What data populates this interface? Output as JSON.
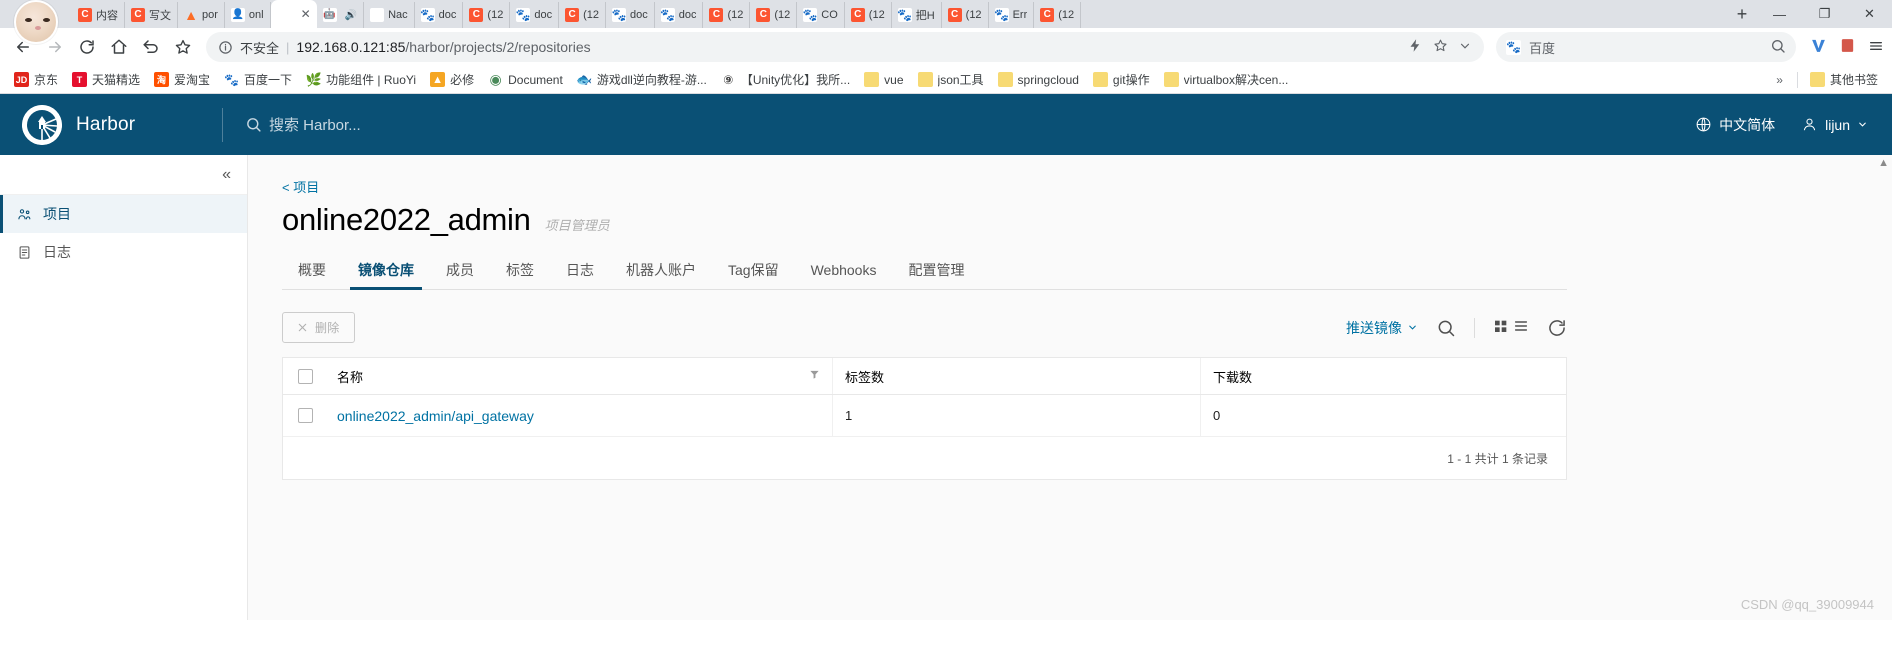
{
  "browser": {
    "tabs": [
      {
        "label": "内容",
        "icon": "csdn-icon",
        "active": false
      },
      {
        "label": "写文",
        "icon": "csdn-icon",
        "active": false
      },
      {
        "label": "por",
        "icon": "gitlab-icon",
        "active": false
      },
      {
        "label": "onl",
        "icon": "avatar-icon",
        "active": false
      },
      {
        "label": "",
        "icon": "harbor-icon",
        "active": true
      },
      {
        "label": "",
        "icon": "robot-icon",
        "active": false
      },
      {
        "label": "Nac",
        "icon": "nacos-icon",
        "active": false
      },
      {
        "label": "doc",
        "icon": "baidu-icon",
        "active": false
      },
      {
        "label": "(12",
        "icon": "csdn-icon",
        "active": false
      },
      {
        "label": "doc",
        "icon": "baidu-icon",
        "active": false
      },
      {
        "label": "(12",
        "icon": "csdn-icon",
        "active": false
      },
      {
        "label": "doc",
        "icon": "baidu-icon",
        "active": false
      },
      {
        "label": "doc",
        "icon": "baidu-icon",
        "active": false
      },
      {
        "label": "(12",
        "icon": "csdn-icon",
        "active": false
      },
      {
        "label": "(12",
        "icon": "csdn-icon",
        "active": false
      },
      {
        "label": "CO",
        "icon": "baidu-icon",
        "active": false
      },
      {
        "label": "(12",
        "icon": "csdn-icon",
        "active": false
      },
      {
        "label": "把H",
        "icon": "baidu-icon",
        "active": false
      },
      {
        "label": "(12",
        "icon": "csdn-icon",
        "active": false
      },
      {
        "label": "Err",
        "icon": "baidu-icon",
        "active": false
      },
      {
        "label": "(12",
        "icon": "csdn-icon",
        "active": false
      }
    ],
    "new_tab_label": "+",
    "window_controls": {
      "minimize": "—",
      "maximize": "❐",
      "close": "✕"
    },
    "toolbar": {
      "back": "←",
      "forward": "→",
      "reload": "⟳",
      "home": "⌂",
      "undo": "↺",
      "bookmark": "☆",
      "insecure_label": "不安全",
      "url_host": "192.168.0.121:85",
      "url_path": "/harbor/projects/2/repositories",
      "search_engine_label": "百度",
      "search_icon": "search-icon"
    },
    "bookmarks": [
      {
        "label": "京东",
        "icon": "jd-icon"
      },
      {
        "label": "天猫精选",
        "icon": "tmall-icon"
      },
      {
        "label": "爱淘宝",
        "icon": "taobao-icon"
      },
      {
        "label": "百度一下",
        "icon": "baidu-icon"
      },
      {
        "label": "功能组件 | RuoYi",
        "icon": "ruoyi-icon"
      },
      {
        "label": "必修",
        "icon": "bixiu-icon"
      },
      {
        "label": "Document",
        "icon": "document-icon"
      },
      {
        "label": "游戏dll逆向教程-游...",
        "icon": "game-icon"
      },
      {
        "label": "【Unity优化】我所...",
        "icon": "unity-icon"
      },
      {
        "label": "vue",
        "icon": "folder-icon"
      },
      {
        "label": "json工具",
        "icon": "folder-icon"
      },
      {
        "label": "springcloud",
        "icon": "folder-icon"
      },
      {
        "label": "git操作",
        "icon": "folder-icon"
      },
      {
        "label": "virtualbox解决cen...",
        "icon": "folder-icon"
      }
    ],
    "bookmarks_overflow": "»",
    "bookmarks_other": {
      "label": "其他书签",
      "icon": "folder-icon"
    }
  },
  "harbor": {
    "brand": "Harbor",
    "search_placeholder": "搜索 Harbor...",
    "language": "中文简体",
    "user": "lijun",
    "collapse_icon": "«"
  },
  "sidebar": {
    "items": [
      {
        "label": "项目",
        "icon": "projects-icon",
        "active": true
      },
      {
        "label": "日志",
        "icon": "logs-icon",
        "active": false
      }
    ]
  },
  "main": {
    "breadcrumb": "< 项目",
    "title": "online2022_admin",
    "role": "项目管理员",
    "tabs": [
      {
        "label": "概要",
        "active": false
      },
      {
        "label": "镜像仓库",
        "active": true
      },
      {
        "label": "成员",
        "active": false
      },
      {
        "label": "标签",
        "active": false
      },
      {
        "label": "日志",
        "active": false
      },
      {
        "label": "机器人账户",
        "active": false
      },
      {
        "label": "Tag保留",
        "active": false
      },
      {
        "label": "Webhooks",
        "active": false
      },
      {
        "label": "配置管理",
        "active": false
      }
    ],
    "toolbar": {
      "delete_label": "删除",
      "delete_icon": "close-icon",
      "push_image_label": "推送镜像",
      "push_image_caret": "chevron-down-icon",
      "search_icon": "search-icon",
      "grid_icon": "grid-view-icon",
      "list_icon": "list-view-icon",
      "refresh_icon": "refresh-icon"
    },
    "table": {
      "columns": [
        "名称",
        "标签数",
        "下载数"
      ],
      "filter_icon": "filter-icon",
      "rows": [
        {
          "name": "online2022_admin/api_gateway",
          "tags": "1",
          "downloads": "0"
        }
      ],
      "pagination": "1 - 1 共计 1 条记录"
    },
    "watermark": "CSDN @qq_39009944"
  }
}
